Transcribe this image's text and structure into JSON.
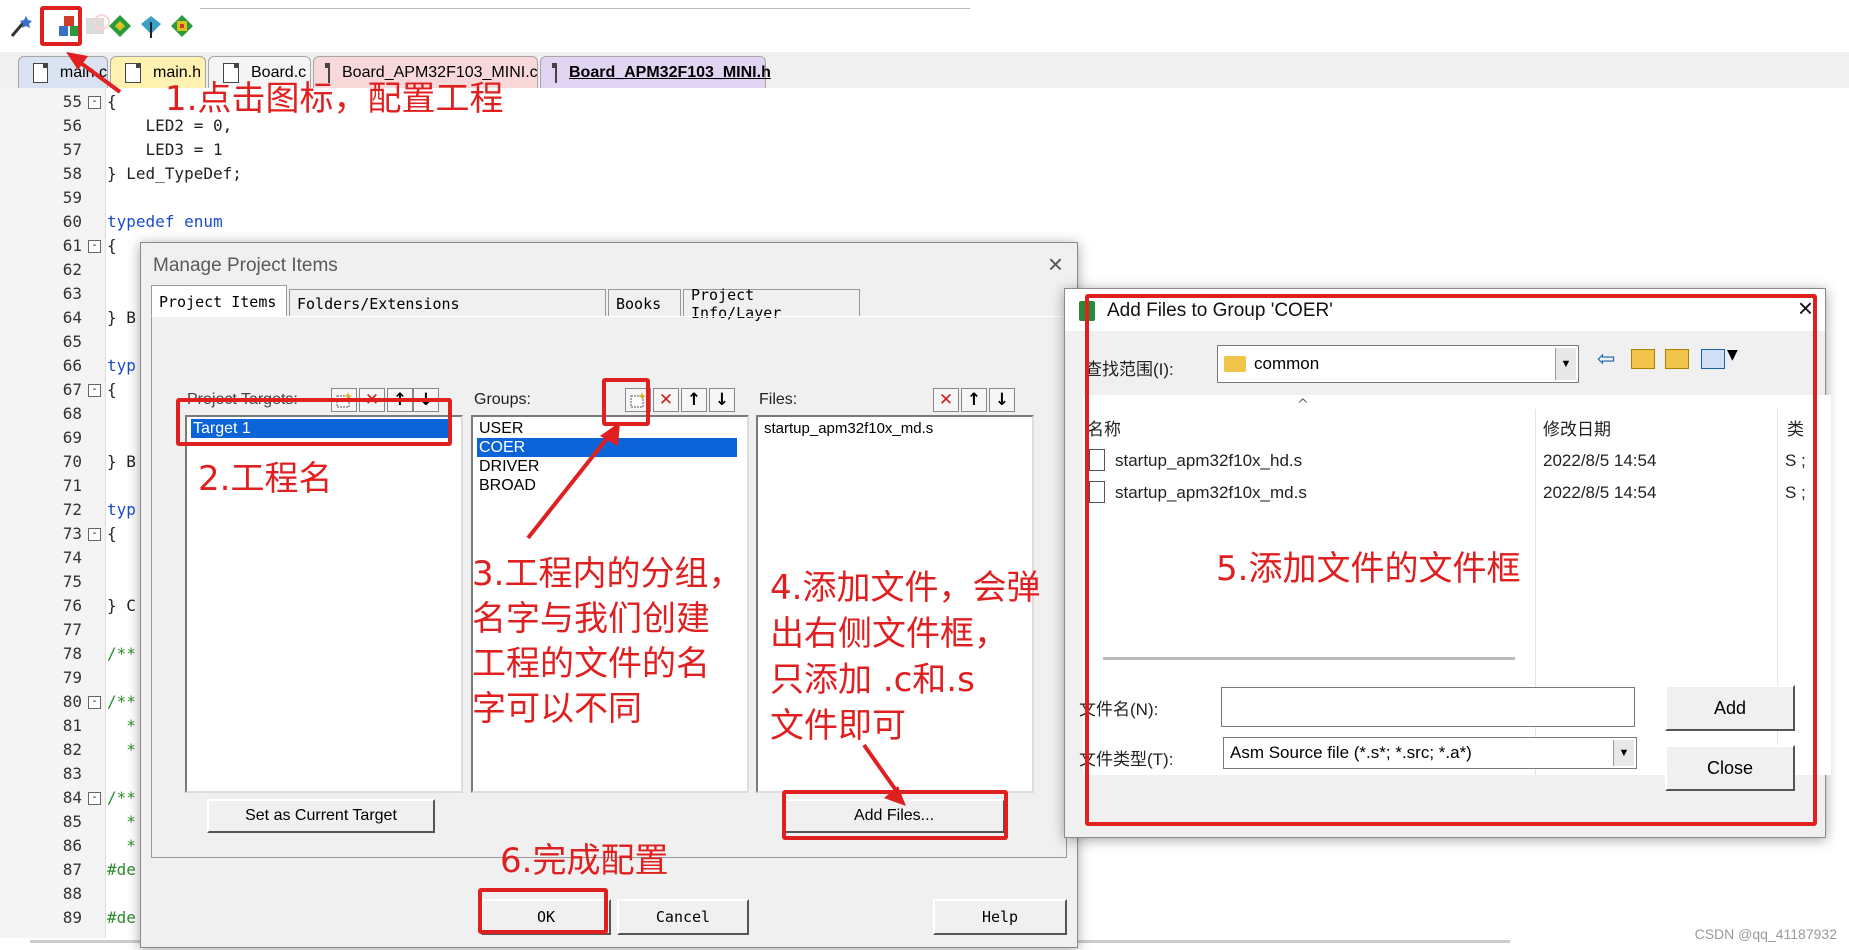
{
  "toolbar": {
    "icons": [
      "magic-wand-icon",
      "manage-project-items-icon",
      "select-packs-icon",
      "green-diamond-icon",
      "jtag-icon",
      "pack-installer-icon"
    ]
  },
  "tabs": [
    {
      "label": "main.c",
      "color": "#d8e2f0"
    },
    {
      "label": "main.h",
      "color": "#fff2b0"
    },
    {
      "label": "Board.c",
      "color": "#f5f5f5"
    },
    {
      "label": "Board_APM32F103_MINI.c",
      "color": "#f8d8d8"
    },
    {
      "label": "Board_APM32F103_MINI.h",
      "color": "#e0d4f2",
      "active": true
    }
  ],
  "editor": {
    "line_numbers": [
      "55",
      "56",
      "57",
      "58",
      "59",
      "60",
      "61",
      "62",
      "63",
      "64",
      "65",
      "66",
      "67",
      "68",
      "69",
      "70",
      "71",
      "72",
      "73",
      "74",
      "75",
      "76",
      "77",
      "78",
      "79",
      "80",
      "81",
      "82",
      "83",
      "84",
      "85",
      "86",
      "87",
      "88",
      "89"
    ],
    "lines": [
      {
        "n": "55",
        "text": "{"
      },
      {
        "n": "56",
        "text": "    LED2 = 0,"
      },
      {
        "n": "57",
        "text": "    LED3 = 1"
      },
      {
        "n": "58",
        "text": "} Led_TypeDef;"
      },
      {
        "n": "60",
        "text": "typedef enum"
      },
      {
        "n": "61",
        "text": "{"
      },
      {
        "n": "64",
        "text": "} B"
      },
      {
        "n": "66",
        "text": "typ"
      },
      {
        "n": "67",
        "text": "{"
      },
      {
        "n": "70",
        "text": "} B"
      },
      {
        "n": "72",
        "text": "typ"
      },
      {
        "n": "73",
        "text": "{"
      },
      {
        "n": "76",
        "text": "} C"
      },
      {
        "n": "78",
        "text": "/**"
      },
      {
        "n": "80",
        "text": "/**"
      },
      {
        "n": "81",
        "text": "  *"
      },
      {
        "n": "82",
        "text": "  *"
      },
      {
        "n": "84",
        "text": "/**"
      },
      {
        "n": "85",
        "text": "  *"
      },
      {
        "n": "86",
        "text": "  *"
      },
      {
        "n": "87",
        "text": "#de"
      },
      {
        "n": "89",
        "text": "#de"
      }
    ]
  },
  "manage_dialog": {
    "title": "Manage Project Items",
    "tabs": [
      "Project Items",
      "Folders/Extensions",
      "Books",
      "Project Info/Layer"
    ],
    "targets_label": "Project Targets:",
    "targets": [
      "Target 1"
    ],
    "groups_label": "Groups:",
    "groups": [
      "USER",
      "COER",
      "DRIVER",
      "BROAD"
    ],
    "selected_group": "COER",
    "files_label": "Files:",
    "files": [
      "startup_apm32f10x_md.s"
    ],
    "set_current_target": "Set as Current Target",
    "add_files": "Add Files...",
    "ok": "OK",
    "cancel": "Cancel",
    "help": "Help"
  },
  "add_files_dialog": {
    "title": "Add Files to Group 'COER'",
    "look_in_label": "查找范围(I):",
    "look_in_value": "common",
    "col_name": "名称",
    "col_date": "修改日期",
    "col_type": "类",
    "files": [
      {
        "name": "startup_apm32f10x_hd.s",
        "date": "2022/8/5 14:54",
        "type": "S ;"
      },
      {
        "name": "startup_apm32f10x_md.s",
        "date": "2022/8/5 14:54",
        "type": "S ;"
      }
    ],
    "filename_label": "文件名(N):",
    "filename_value": "",
    "filetype_label": "文件类型(T):",
    "filetype_value": "Asm Source file (*.s*; *.src; *.a*)",
    "add": "Add",
    "close": "Close"
  },
  "annotations": {
    "a1": "1.点击图标，配置工程",
    "a2": "2.工程名",
    "a3": "3.工程内的分组，\n名字与我们创建\n工程的文件的名\n字可以不同",
    "a4": "4.添加文件，会弹\n出右侧文件框，\n只添加 .c和.s\n文件即可",
    "a5": "5.添加文件的文件框",
    "a6": "6.完成配置",
    "color": "#e02020"
  },
  "watermark": "CSDN @qq_41187932"
}
